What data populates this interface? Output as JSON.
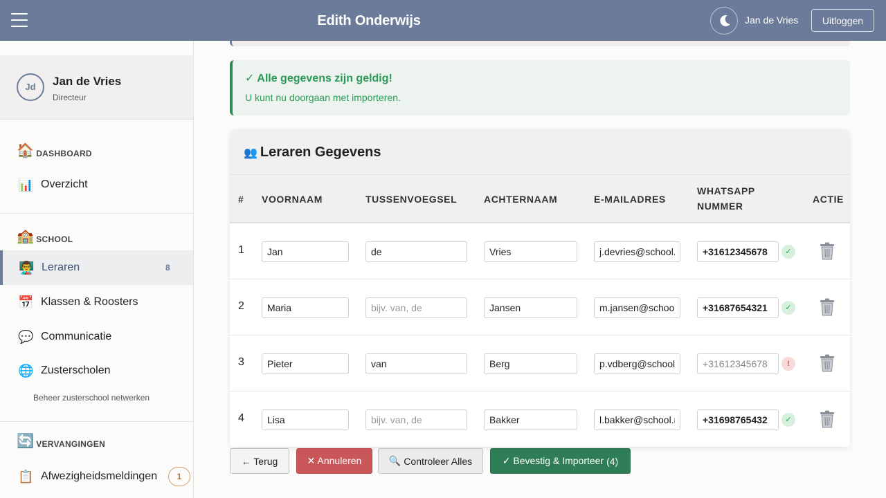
{
  "header": {
    "title": "Edith Onderwijs",
    "user_name": "Jan de Vries",
    "logout_label": "Uitloggen"
  },
  "sidebar": {
    "profile": {
      "initials": "Jd",
      "name": "Jan de Vries",
      "role": "Directeur"
    },
    "sections": [
      {
        "icon": "🏠",
        "label": "DASHBOARD"
      },
      {
        "icon": "🏫",
        "label": "SCHOOL"
      },
      {
        "icon": "🔄",
        "label": "VERVANGINGEN"
      }
    ],
    "items": [
      {
        "icon": "📊",
        "label": "Overzicht"
      },
      {
        "icon": "👨‍🏫",
        "label": "Leraren",
        "badge": "8"
      },
      {
        "icon": "📅",
        "label": "Klassen & Roosters"
      },
      {
        "icon": "💬",
        "label": "Communicatie"
      },
      {
        "icon": "🌐",
        "label": "Zusterscholen",
        "sub": "Beheer zusterschool netwerken"
      },
      {
        "icon": "📋",
        "label": "Afwezigheidsmeldingen",
        "badge": "1"
      }
    ]
  },
  "alert": {
    "title": "✓ Alle gegevens zijn geldig!",
    "text": "U kunt nu doorgaan met importeren."
  },
  "table": {
    "icon": "👥",
    "title": "Leraren Gegevens",
    "columns": [
      "#",
      "VOORNAAM",
      "TUSSENVOEGSEL",
      "ACHTERNAAM",
      "E-MAILADRES",
      "WHATSAPP",
      "NUMMER",
      "ACTIE"
    ],
    "placeholder_tussenvoegsel": "bijv. van, de",
    "rows": [
      {
        "num": "1",
        "voornaam": "Jan",
        "tussenvoegsel": "de",
        "achternaam": "Vries",
        "email": "j.devries@school.nl",
        "whatsapp": "+31612345678",
        "valid": true
      },
      {
        "num": "2",
        "voornaam": "Maria",
        "tussenvoegsel": "",
        "achternaam": "Jansen",
        "email": "m.jansen@school.nl",
        "whatsapp": "+31687654321",
        "valid": true
      },
      {
        "num": "3",
        "voornaam": "Pieter",
        "tussenvoegsel": "van",
        "achternaam": "Berg",
        "email": "p.vdberg@school.nl",
        "whatsapp": "+31612345678",
        "valid": false
      },
      {
        "num": "4",
        "voornaam": "Lisa",
        "tussenvoegsel": "",
        "achternaam": "Bakker",
        "email": "l.bakker@school.nl",
        "whatsapp": "+31698765432",
        "valid": true
      }
    ]
  },
  "status_icons": {
    "ok": "✓",
    "bad": "!"
  },
  "footer": {
    "back_label": "← Terug",
    "cancel_label": "✕ Annuleren",
    "check_icon": "🔍",
    "check_label": "Controleer Alles",
    "confirm_label": "✓ Bevestig & Importeer",
    "confirm_count": "(4)"
  },
  "colors": {
    "topbar": "#6b7b99",
    "success": "#2b9a57",
    "danger": "#c9575a",
    "confirm": "#2f7d57"
  }
}
